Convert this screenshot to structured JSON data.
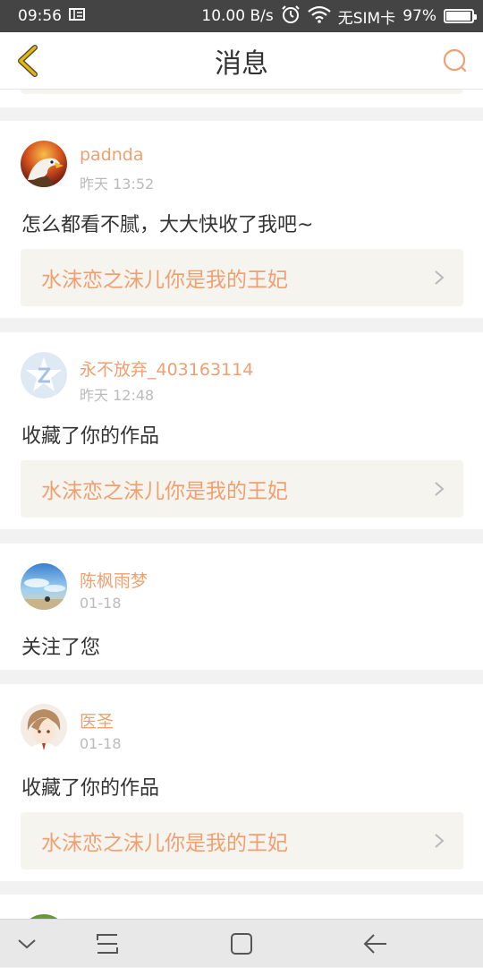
{
  "status_bar": {
    "time": "09:56",
    "speed": "10.00 B/s",
    "sim": "无SIM卡",
    "battery": "97%",
    "battery_level": 0.97
  },
  "header": {
    "title": "消息"
  },
  "messages": [
    {
      "username": "padnda",
      "time": "昨天 13:52",
      "text": "怎么都看不腻，大大快收了我吧~",
      "work": "水沫恋之沫儿你是我的王妃"
    },
    {
      "username": "永不放弃_403163114",
      "time": "昨天 12:48",
      "text": "收藏了你的作品",
      "work": "水沫恋之沫儿你是我的王妃"
    },
    {
      "username": "陈枫雨梦",
      "time": "01-18",
      "text": "关注了您"
    },
    {
      "username": "医圣",
      "time": "01-18",
      "text": "收藏了你的作品",
      "work": "水沫恋之沫儿你是我的王妃"
    }
  ],
  "icons": {
    "back": "chevron-left-icon",
    "search": "search-icon",
    "nav_hide": "chevron-down-icon",
    "nav_recent": "recent-apps-icon",
    "nav_home": "home-icon",
    "nav_back": "back-arrow-icon"
  },
  "colors": {
    "accent": "#f0a070",
    "back_arrow": "#e6b800",
    "status_bar": "#444444",
    "work_box": "#f5f4ef"
  }
}
